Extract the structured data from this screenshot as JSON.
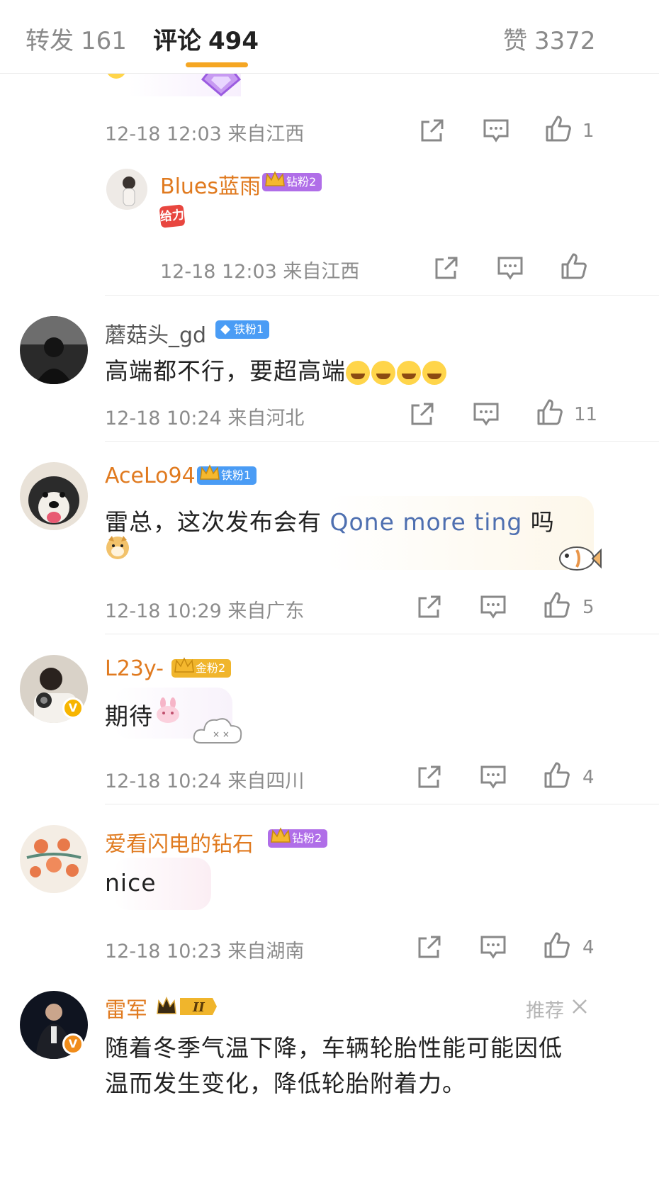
{
  "tabs": {
    "repost": {
      "label": "转发",
      "count": "161"
    },
    "comment": {
      "label": "评论",
      "count": "494"
    },
    "like": {
      "label": "赞",
      "count": "3372"
    }
  },
  "colors": {
    "accent": "#f5a623",
    "username": "#e07a1f",
    "meta": "#8c8c8c"
  },
  "top_comment": {
    "meta": "12-18 12:03 来自江西",
    "likes": "1"
  },
  "reply": {
    "username": "Blues蓝雨",
    "badge": "钻粉2",
    "sticker_text": "给力",
    "meta": "12-18 12:03 来自江西"
  },
  "comments": [
    {
      "username": "蘑菇头_gd",
      "badge": "铁粉1",
      "text": "高端都不行，要超高端",
      "meta": "12-18 10:24 来自河北",
      "likes": "11"
    },
    {
      "username": "AceLo94",
      "badge": "铁粉1",
      "text_before": "雷总，这次发布会有 ",
      "link_text": "Qone more ting",
      "text_after": " 吗",
      "meta": "12-18 10:29 来自广东",
      "likes": "5"
    },
    {
      "username": "L23y-",
      "badge": "金粉2",
      "text": "期待",
      "meta": "12-18 10:24 来自四川",
      "likes": "4"
    },
    {
      "username": "爱看闪电的钻石",
      "badge": "钻粉2",
      "text": "nice",
      "meta": "12-18 10:23 来自湖南",
      "likes": "4"
    },
    {
      "username": "雷军",
      "badge": "II",
      "recommend": "推荐",
      "text_line1": "随着冬季气温下降，车辆轮胎性能可能因低",
      "text_line2": "温而发生变化，降低轮胎附着力。"
    }
  ]
}
